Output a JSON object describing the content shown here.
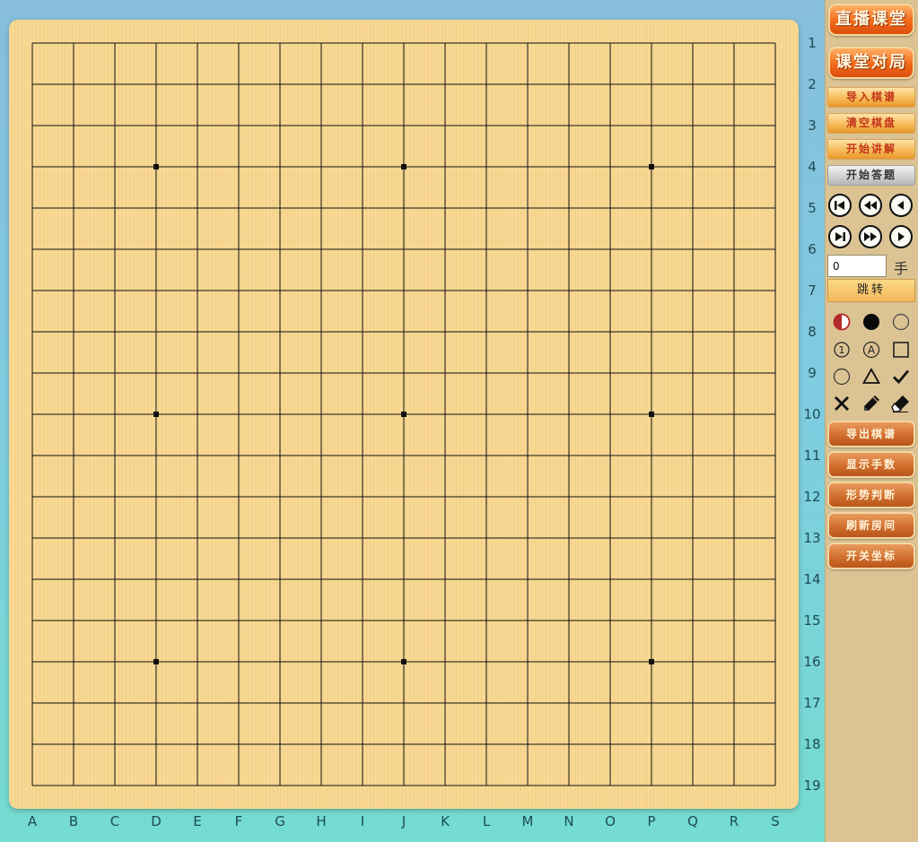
{
  "board": {
    "size": 19,
    "column_labels": [
      "A",
      "B",
      "C",
      "D",
      "E",
      "F",
      "G",
      "H",
      "I",
      "J",
      "K",
      "L",
      "M",
      "N",
      "O",
      "P",
      "Q",
      "R",
      "S"
    ],
    "row_labels": [
      "1",
      "2",
      "3",
      "4",
      "5",
      "6",
      "7",
      "8",
      "9",
      "10",
      "11",
      "12",
      "13",
      "14",
      "15",
      "16",
      "17",
      "18",
      "19"
    ],
    "star_points": [
      [
        4,
        4
      ],
      [
        10,
        4
      ],
      [
        16,
        4
      ],
      [
        4,
        10
      ],
      [
        10,
        10
      ],
      [
        16,
        10
      ],
      [
        4,
        16
      ],
      [
        10,
        16
      ],
      [
        16,
        16
      ]
    ],
    "colors": {
      "wood": "#f8d68d",
      "line": "#111111"
    }
  },
  "side_panel": {
    "live_class_label": "直播课堂",
    "class_game_label": "课堂对局",
    "import_record_label": "导入棋谱",
    "clear_board_label": "清空棋盘",
    "start_lecture_label": "开始讲解",
    "start_answer_label": "开始答题",
    "move_input_value": "0",
    "move_unit_label": "手",
    "jump_label": "跳转",
    "export_record_label": "导出棋谱",
    "show_move_numbers_label": "显示手数",
    "position_judgement_label": "形势判断",
    "refresh_room_label": "刷新房间",
    "toggle_coordinates_label": "开关坐标"
  },
  "nav_icons": [
    "skip-to-start-icon",
    "rewind-icon",
    "step-back-icon",
    "skip-to-end-icon",
    "fast-forward-icon",
    "play-icon"
  ],
  "tool_icons": [
    "alternate-color-icon",
    "black-stone-icon",
    "white-stone-icon",
    "number-mark-icon",
    "letter-mark-icon",
    "square-mark-icon",
    "circle-mark-icon",
    "triangle-mark-icon",
    "check-mark-icon",
    "cross-mark-icon",
    "pencil-icon",
    "eraser-icon"
  ],
  "tool_glyphs": {
    "number_mark": "1",
    "letter_mark": "A"
  }
}
